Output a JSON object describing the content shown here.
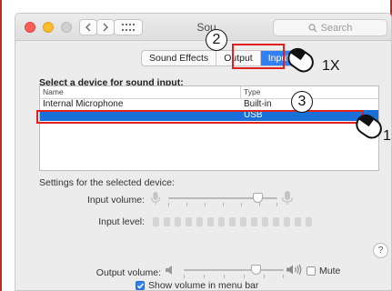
{
  "window": {
    "title": "Sou",
    "search_placeholder": "Search"
  },
  "tabs": [
    {
      "label": "Sound Effects",
      "active": false
    },
    {
      "label": "Output",
      "active": false
    },
    {
      "label": "Input",
      "active": true
    }
  ],
  "input_section": {
    "heading": "Select a device for sound input:",
    "columns": [
      "Name",
      "Type"
    ],
    "rows": [
      {
        "name": "Internal Microphone",
        "type": "Built-in",
        "selected": false
      },
      {
        "name": "",
        "type": "USB",
        "selected": true
      }
    ]
  },
  "settings": {
    "heading": "Settings for the selected device:",
    "input_volume_label": "Input volume:",
    "input_volume_level": 0.82,
    "input_level_label": "Input level:",
    "input_level_segments": 15
  },
  "output": {
    "label": "Output volume:",
    "level": 0.72,
    "mute_label": "Mute",
    "mute_checked": false,
    "show_in_menu_bar_label": "Show volume in menu bar",
    "show_in_menu_bar_checked": true
  },
  "help_label": "?",
  "annotations": {
    "step_2": "2",
    "step_3": "3",
    "click_1": "1X",
    "click_2": "1"
  },
  "colors": {
    "accent": "#2f7ff6",
    "selection": "#1b6fd8",
    "annotation_red": "#e0201e"
  }
}
